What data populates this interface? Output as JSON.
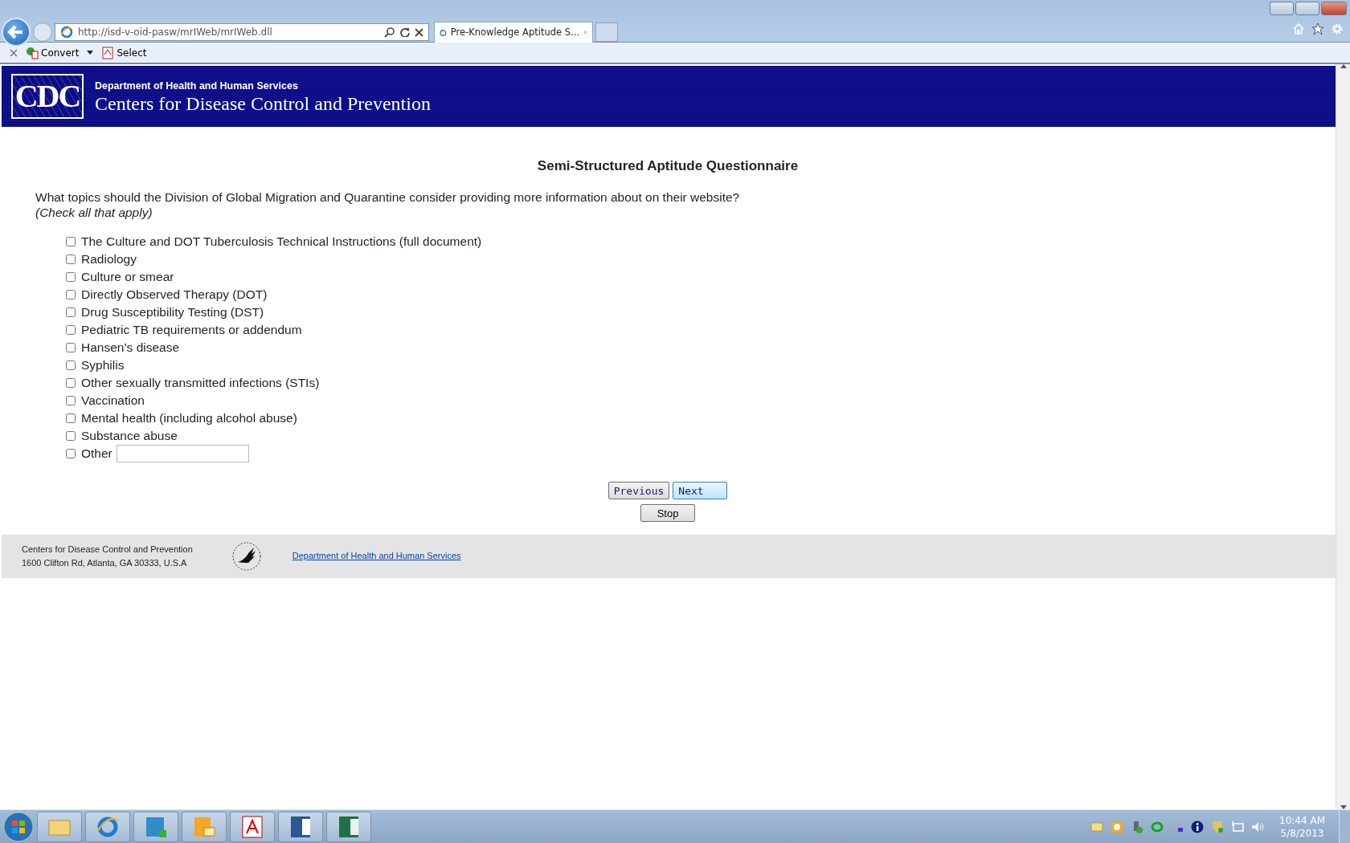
{
  "browser": {
    "address": "http://isd-v-oid-pasw/mrIWeb/mrIWeb.dll",
    "tabs": [
      {
        "title": "Pre-Knowledge Aptitude S...",
        "selected": true
      }
    ],
    "commands": [
      "Convert",
      "Select"
    ]
  },
  "header": {
    "logo": "CDC",
    "department": "Department of Health and Human Services",
    "agency": "Centers for Disease Control and Prevention"
  },
  "survey": {
    "title": "Semi-Structured Aptitude Questionnaire",
    "question": "What topics should the Division of Global Migration and Quarantine consider providing more information about on their website?",
    "instruction": "(Check all that apply)",
    "options": [
      {
        "label": "The Culture and DOT Tuberculosis Technical Instructions (full document)",
        "checked": false
      },
      {
        "label": "Radiology",
        "checked": false
      },
      {
        "label": "Culture or smear",
        "checked": false
      },
      {
        "label": "Directly Observed Therapy (DOT)",
        "checked": false
      },
      {
        "label": "Drug Susceptibility Testing (DST)",
        "checked": false
      },
      {
        "label": "Pediatric TB requirements or addendum",
        "checked": false
      },
      {
        "label": "Hansen’s disease",
        "checked": false
      },
      {
        "label": "Syphilis",
        "checked": false
      },
      {
        "label": "Other sexually transmitted infections (STIs)",
        "checked": false
      },
      {
        "label": "Vaccination",
        "checked": false
      },
      {
        "label": "Mental health (including alcohol abuse)",
        "checked": false
      },
      {
        "label": "Substance abuse",
        "checked": false
      },
      {
        "label": "Other",
        "checked": false,
        "kind": "text"
      }
    ],
    "nav_buttons": [
      "Previous",
      "Next"
    ],
    "stop_button": "Stop"
  },
  "footer": {
    "organization": "Centers for Disease Control and Prevention",
    "address": "1600 Clifton Rd, Atlanta, GA 30333, U.S.A",
    "link": "Department of Health and Human Services"
  },
  "taskbar": {
    "time": "10:44 AM",
    "date": "5/8/2013"
  }
}
